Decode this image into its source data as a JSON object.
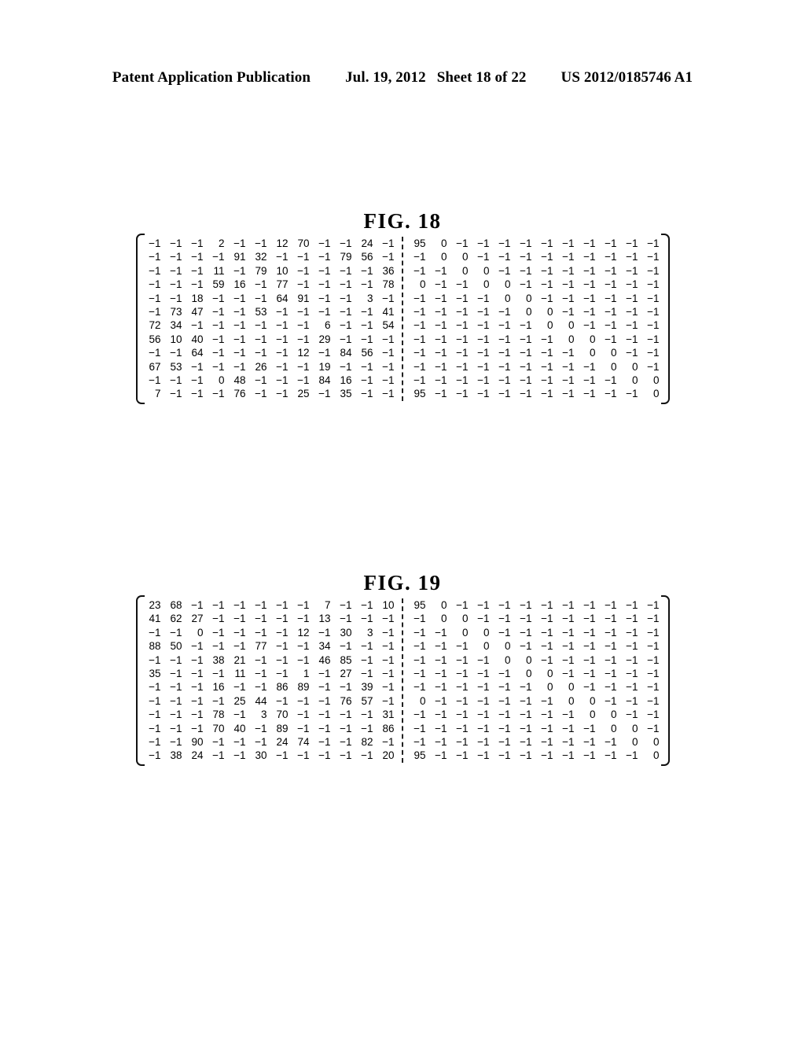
{
  "header": {
    "publication": "Patent Application Publication",
    "date": "Jul. 19, 2012",
    "sheet": "Sheet 18 of 22",
    "document_number": "US 2012/0185746 A1"
  },
  "figures": [
    {
      "id": "fig-18",
      "title": "FIG. 18",
      "matrix": {
        "rows": 12,
        "cols": 24,
        "split_after_column": 12,
        "divider": "dashed",
        "left_block": [
          [
            -1,
            -1,
            -1,
            2,
            -1,
            -1,
            12,
            70,
            -1,
            -1,
            24,
            -1
          ],
          [
            -1,
            -1,
            -1,
            -1,
            91,
            32,
            -1,
            -1,
            -1,
            79,
            56,
            -1
          ],
          [
            -1,
            -1,
            -1,
            11,
            -1,
            79,
            10,
            -1,
            -1,
            -1,
            -1,
            36
          ],
          [
            -1,
            -1,
            -1,
            59,
            16,
            -1,
            77,
            -1,
            -1,
            -1,
            -1,
            78
          ],
          [
            -1,
            -1,
            18,
            -1,
            -1,
            -1,
            64,
            91,
            -1,
            -1,
            3,
            -1
          ],
          [
            -1,
            73,
            47,
            -1,
            -1,
            53,
            -1,
            -1,
            -1,
            -1,
            -1,
            41
          ],
          [
            72,
            34,
            -1,
            -1,
            -1,
            -1,
            -1,
            -1,
            6,
            -1,
            -1,
            54
          ],
          [
            56,
            10,
            40,
            -1,
            -1,
            -1,
            -1,
            -1,
            29,
            -1,
            -1,
            -1
          ],
          [
            -1,
            -1,
            64,
            -1,
            -1,
            -1,
            -1,
            12,
            -1,
            84,
            56,
            -1
          ],
          [
            67,
            53,
            -1,
            -1,
            -1,
            26,
            -1,
            -1,
            19,
            -1,
            -1,
            -1
          ],
          [
            -1,
            -1,
            -1,
            0,
            48,
            -1,
            -1,
            -1,
            84,
            16,
            -1,
            -1
          ],
          [
            7,
            -1,
            -1,
            -1,
            76,
            -1,
            -1,
            25,
            -1,
            35,
            -1,
            -1
          ]
        ],
        "right_block": [
          [
            95,
            0,
            -1,
            -1,
            -1,
            -1,
            -1,
            -1,
            -1,
            -1,
            -1,
            -1
          ],
          [
            -1,
            0,
            0,
            -1,
            -1,
            -1,
            -1,
            -1,
            -1,
            -1,
            -1,
            -1
          ],
          [
            -1,
            -1,
            0,
            0,
            -1,
            -1,
            -1,
            -1,
            -1,
            -1,
            -1,
            -1
          ],
          [
            0,
            -1,
            -1,
            0,
            0,
            -1,
            -1,
            -1,
            -1,
            -1,
            -1,
            -1
          ],
          [
            -1,
            -1,
            -1,
            -1,
            0,
            0,
            -1,
            -1,
            -1,
            -1,
            -1,
            -1
          ],
          [
            -1,
            -1,
            -1,
            -1,
            -1,
            0,
            0,
            -1,
            -1,
            -1,
            -1,
            -1
          ],
          [
            -1,
            -1,
            -1,
            -1,
            -1,
            -1,
            0,
            0,
            -1,
            -1,
            -1,
            -1
          ],
          [
            -1,
            -1,
            -1,
            -1,
            -1,
            -1,
            -1,
            0,
            0,
            -1,
            -1,
            -1
          ],
          [
            -1,
            -1,
            -1,
            -1,
            -1,
            -1,
            -1,
            -1,
            0,
            0,
            -1,
            -1
          ],
          [
            -1,
            -1,
            -1,
            -1,
            -1,
            -1,
            -1,
            -1,
            -1,
            0,
            0,
            -1
          ],
          [
            -1,
            -1,
            -1,
            -1,
            -1,
            -1,
            -1,
            -1,
            -1,
            -1,
            0,
            0
          ],
          [
            95,
            -1,
            -1,
            -1,
            -1,
            -1,
            -1,
            -1,
            -1,
            -1,
            -1,
            0
          ]
        ]
      }
    },
    {
      "id": "fig-19",
      "title": "FIG. 19",
      "matrix": {
        "rows": 12,
        "cols": 24,
        "split_after_column": 12,
        "divider": "dashed",
        "left_block": [
          [
            23,
            68,
            -1,
            -1,
            -1,
            -1,
            -1,
            -1,
            7,
            -1,
            -1,
            10
          ],
          [
            41,
            62,
            27,
            -1,
            -1,
            -1,
            -1,
            -1,
            13,
            -1,
            -1,
            -1
          ],
          [
            -1,
            -1,
            0,
            -1,
            -1,
            -1,
            -1,
            12,
            -1,
            30,
            3,
            -1
          ],
          [
            88,
            50,
            -1,
            -1,
            -1,
            77,
            -1,
            -1,
            34,
            -1,
            -1,
            -1
          ],
          [
            -1,
            -1,
            -1,
            38,
            21,
            -1,
            -1,
            -1,
            46,
            85,
            -1,
            -1
          ],
          [
            35,
            -1,
            -1,
            -1,
            11,
            -1,
            -1,
            1,
            -1,
            27,
            -1,
            -1
          ],
          [
            -1,
            -1,
            -1,
            16,
            -1,
            -1,
            86,
            89,
            -1,
            -1,
            39,
            -1
          ],
          [
            -1,
            -1,
            -1,
            -1,
            25,
            44,
            -1,
            -1,
            -1,
            76,
            57,
            -1
          ],
          [
            -1,
            -1,
            -1,
            78,
            -1,
            3,
            70,
            -1,
            -1,
            -1,
            -1,
            31
          ],
          [
            -1,
            -1,
            -1,
            70,
            40,
            -1,
            89,
            -1,
            -1,
            -1,
            -1,
            86
          ],
          [
            -1,
            -1,
            90,
            -1,
            -1,
            -1,
            24,
            74,
            -1,
            -1,
            82,
            -1
          ],
          [
            -1,
            38,
            24,
            -1,
            -1,
            30,
            -1,
            -1,
            -1,
            -1,
            -1,
            20
          ]
        ],
        "right_block": [
          [
            95,
            0,
            -1,
            -1,
            -1,
            -1,
            -1,
            -1,
            -1,
            -1,
            -1,
            -1
          ],
          [
            -1,
            0,
            0,
            -1,
            -1,
            -1,
            -1,
            -1,
            -1,
            -1,
            -1,
            -1
          ],
          [
            -1,
            -1,
            0,
            0,
            -1,
            -1,
            -1,
            -1,
            -1,
            -1,
            -1,
            -1
          ],
          [
            -1,
            -1,
            -1,
            0,
            0,
            -1,
            -1,
            -1,
            -1,
            -1,
            -1,
            -1
          ],
          [
            -1,
            -1,
            -1,
            -1,
            0,
            0,
            -1,
            -1,
            -1,
            -1,
            -1,
            -1
          ],
          [
            -1,
            -1,
            -1,
            -1,
            -1,
            0,
            0,
            -1,
            -1,
            -1,
            -1,
            -1
          ],
          [
            -1,
            -1,
            -1,
            -1,
            -1,
            -1,
            0,
            0,
            -1,
            -1,
            -1,
            -1
          ],
          [
            0,
            -1,
            -1,
            -1,
            -1,
            -1,
            -1,
            0,
            0,
            -1,
            -1,
            -1
          ],
          [
            -1,
            -1,
            -1,
            -1,
            -1,
            -1,
            -1,
            -1,
            0,
            0,
            -1,
            -1
          ],
          [
            -1,
            -1,
            -1,
            -1,
            -1,
            -1,
            -1,
            -1,
            -1,
            0,
            0,
            -1
          ],
          [
            -1,
            -1,
            -1,
            -1,
            -1,
            -1,
            -1,
            -1,
            -1,
            -1,
            0,
            0
          ],
          [
            95,
            -1,
            -1,
            -1,
            -1,
            -1,
            -1,
            -1,
            -1,
            -1,
            -1,
            0
          ]
        ]
      }
    }
  ]
}
